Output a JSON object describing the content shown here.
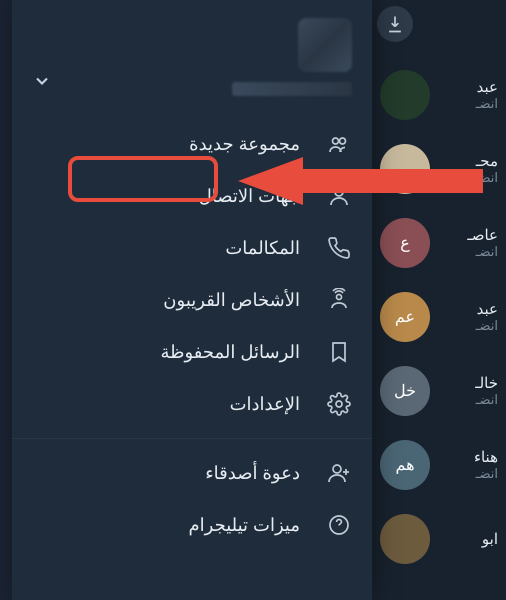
{
  "header": {
    "chevron_title": "expand"
  },
  "menu": {
    "new_group": "مجموعة جديدة",
    "contacts": "جهات الاتصال",
    "calls": "المكالمات",
    "nearby": "الأشخاص القريبون",
    "saved": "الرسائل المحفوظة",
    "settings": "الإعدادات",
    "invite": "دعوة أصدقاء",
    "features": "ميزات تيليجرام"
  },
  "chats": [
    {
      "name": "عبد",
      "sub": "انضـ",
      "initials": "",
      "color": "#223b2b"
    },
    {
      "name": "محـ",
      "sub": "انضـ",
      "initials": "",
      "color": "#c7b99c"
    },
    {
      "name": "عاصـ",
      "sub": "انضـ",
      "initials": "ع",
      "color": "#8a4f55"
    },
    {
      "name": "عبد",
      "sub": "انضـ",
      "initials": "عم",
      "color": "#b8894a"
    },
    {
      "name": "خالـ",
      "sub": "انضـ",
      "initials": "خل",
      "color": "#5a6875"
    },
    {
      "name": "هناء",
      "sub": "انضـ",
      "initials": "هم",
      "color": "#4a6574"
    },
    {
      "name": "ابو",
      "sub": "",
      "initials": "",
      "color": "#6d5b3e"
    }
  ],
  "colors": {
    "highlight": "#e74c3c"
  }
}
